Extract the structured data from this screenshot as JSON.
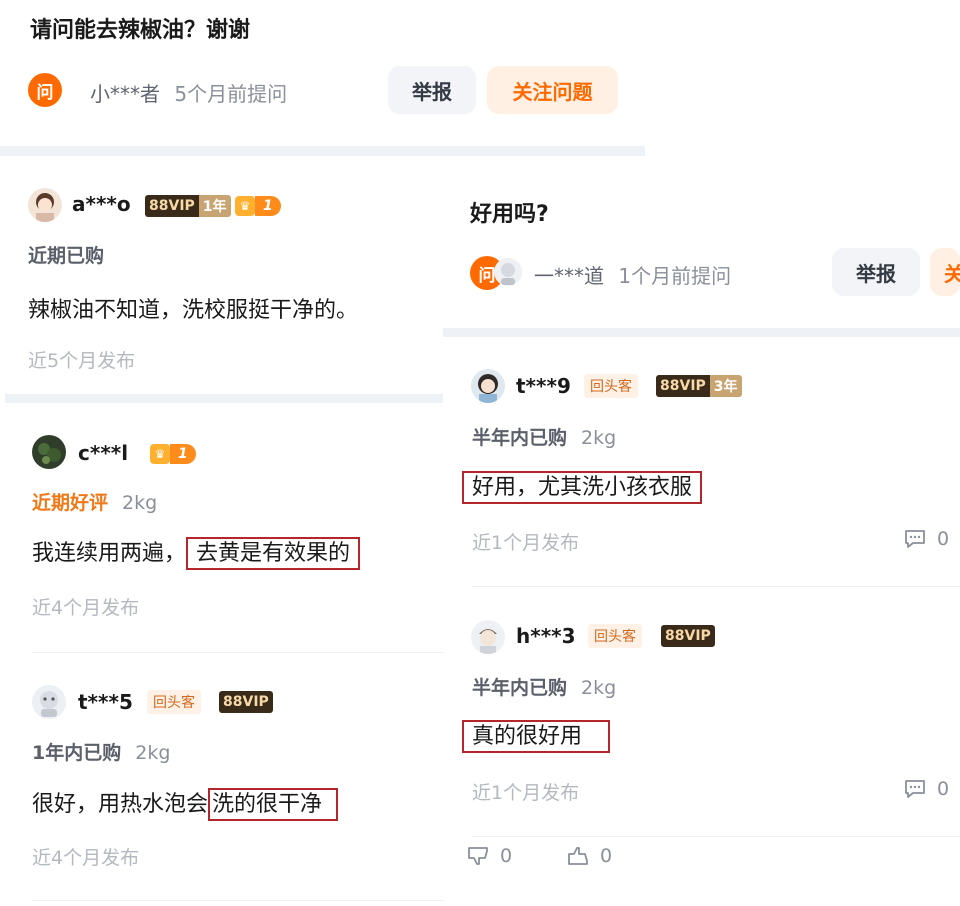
{
  "q1": {
    "title": "请问能去辣椒油？谢谢",
    "icon": "问",
    "user": "小***者",
    "time": "5个月前提问",
    "report": "举报",
    "follow": "关注问题"
  },
  "q2": {
    "title": "好用吗?",
    "icon": "问",
    "user": "一***道",
    "time": "1个月前提问",
    "report": "举报",
    "follow": "关"
  },
  "left": [
    {
      "user": "a***o",
      "vip": "88VIP",
      "vip_years": "1年",
      "rank": "1",
      "tag": "近期已购",
      "spec": "",
      "text": "辣椒油不知道，洗校服挺干净的。",
      "highlight": "",
      "time": "近5个月发布"
    },
    {
      "user": "c***l",
      "rank": "1",
      "tag": "近期好评",
      "spec": "2kg",
      "text": "我连续用两遍，",
      "highlight": "去黄是有效果的",
      "time": "近4个月发布"
    },
    {
      "user": "t***5",
      "returning": "回头客",
      "vip": "88VIP",
      "tag": "1年内已购",
      "spec": "2kg",
      "text": "很好，用热水泡会",
      "highlight": "洗的很干净",
      "time": "近4个月发布"
    }
  ],
  "right": [
    {
      "user": "t***9",
      "returning": "回头客",
      "vip": "88VIP",
      "vip_years": "3年",
      "tag": "半年内已购",
      "spec": "2kg",
      "text": "",
      "highlight": "好用，尤其洗小孩衣服",
      "time": "近1个月发布",
      "comments": "0"
    },
    {
      "user": "h***3",
      "returning": "回头客",
      "vip": "88VIP",
      "tag": "半年内已购",
      "spec": "2kg",
      "text": "",
      "highlight": "真的很好用",
      "time": "近1个月发布",
      "comments": "0"
    }
  ],
  "bottom": {
    "dislike": "0",
    "like": "0"
  },
  "icons": {
    "comment": "comment-icon",
    "dislike": "thumbs-down-icon",
    "like": "thumbs-up-icon",
    "crown": "crown-icon"
  },
  "colors": {
    "accent": "#ff6a00",
    "highlight_border": "#b3262b"
  }
}
